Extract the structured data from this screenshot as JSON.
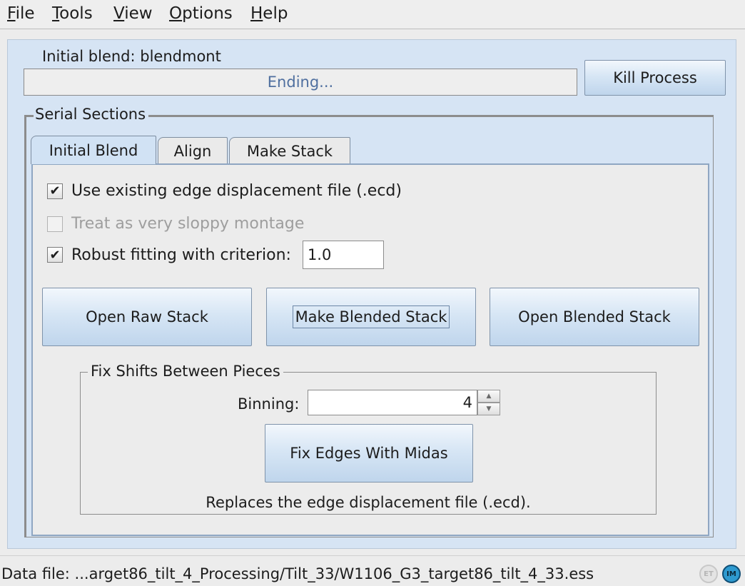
{
  "menu": [
    {
      "mnemonic": "F",
      "rest": "ile"
    },
    {
      "mnemonic": "T",
      "rest": "ools"
    },
    {
      "mnemonic": "V",
      "rest": "iew"
    },
    {
      "mnemonic": "O",
      "rest": "ptions"
    },
    {
      "mnemonic": "H",
      "rest": "elp"
    }
  ],
  "process": {
    "label": "Initial blend: blendmont",
    "progress_text": "Ending...",
    "kill_label": "Kill Process"
  },
  "serial": {
    "title": "Serial Sections",
    "tabs": [
      "Initial Blend",
      "Align",
      "Make Stack"
    ],
    "active_tab": "Initial Blend"
  },
  "options": {
    "use_existing": {
      "label": "Use existing edge displacement file (.ecd)",
      "checked": true,
      "enabled": true
    },
    "sloppy": {
      "label": "Treat as very sloppy montage",
      "checked": false,
      "enabled": false
    },
    "robust": {
      "label": "Robust fitting with criterion:",
      "checked": true,
      "enabled": true,
      "value": "1.0"
    }
  },
  "buttons": {
    "open_raw": "Open Raw Stack",
    "make_blended": "Make Blended Stack",
    "open_blended": "Open Blended Stack"
  },
  "fix_shifts": {
    "title": "Fix Shifts Between Pieces",
    "binning_label": "Binning:",
    "binning_value": "4",
    "fix_edges_button": "Fix Edges With Midas",
    "note": "Replaces the edge displacement file (.ecd)."
  },
  "statusbar": {
    "data_file": "Data file: ...arget86_tilt_4_Processing/Tilt_33/W1106_G3_target86_tilt_4_33.ess",
    "et_icon": "ET",
    "im_icon": "IM"
  },
  "colors": {
    "panel_bg": "#d6e4f4",
    "button_gradient": [
      "#f2f7fc",
      "#bfd5ec"
    ],
    "progress_text": "#4f6f9f"
  }
}
